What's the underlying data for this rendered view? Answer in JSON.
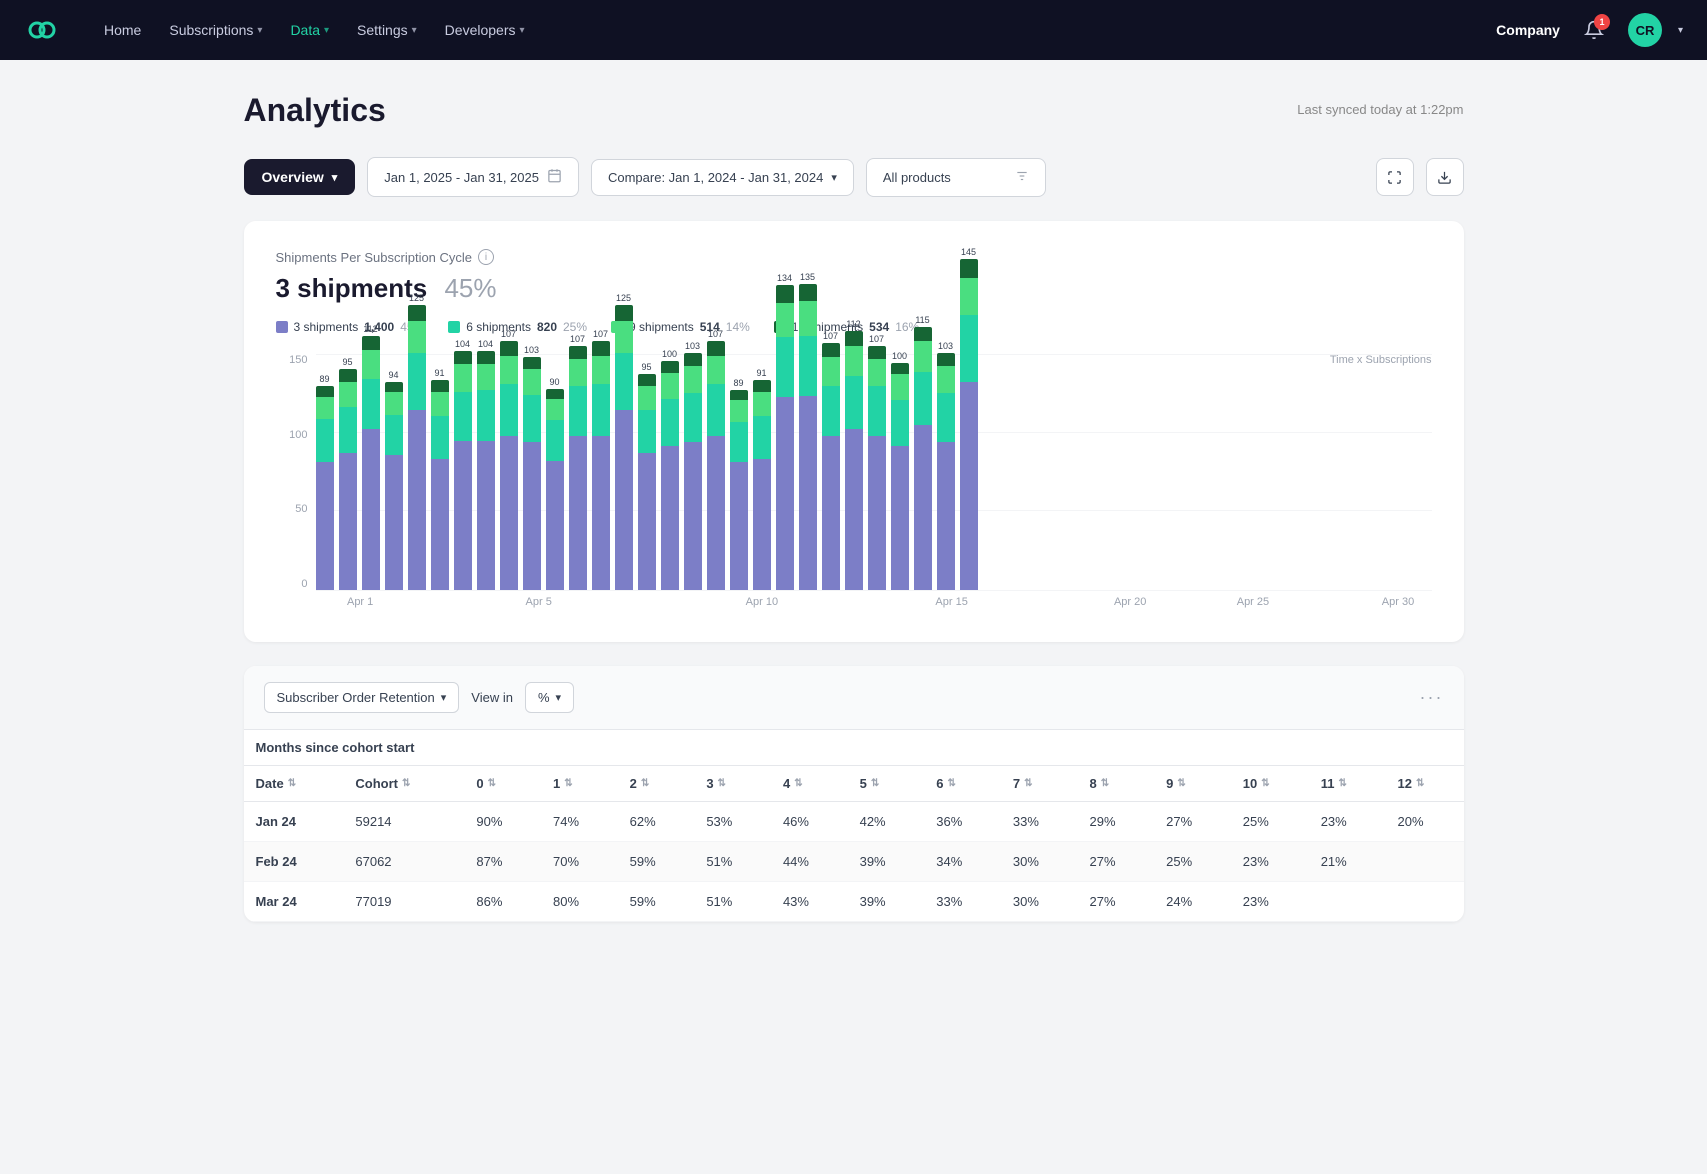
{
  "navbar": {
    "logo_alt": "Logo",
    "nav_items": [
      {
        "label": "Home",
        "active": false
      },
      {
        "label": "Subscriptions",
        "active": false,
        "has_chevron": true
      },
      {
        "label": "Data",
        "active": true,
        "has_chevron": true
      },
      {
        "label": "Settings",
        "active": false,
        "has_chevron": true
      },
      {
        "label": "Developers",
        "active": false,
        "has_chevron": true
      }
    ],
    "company": "Company",
    "notification_count": "1",
    "avatar_initials": "CR"
  },
  "page": {
    "title": "Analytics",
    "sync_text": "Last synced today at 1:22pm"
  },
  "toolbar": {
    "overview_label": "Overview",
    "date_range": "Jan 1, 2025 - Jan 31, 2025",
    "compare_label": "Compare: Jan 1, 2024 - Jan 31, 2024",
    "products_label": "All products"
  },
  "chart": {
    "title": "Shipments Per Subscription Cycle",
    "headline": "3 shipments",
    "headline_pct": "45%",
    "y_axis_label": "Time x Subscriptions",
    "legend": [
      {
        "label": "3 shipments",
        "color": "#7c7ec7",
        "count": "1,400",
        "pct": "45%"
      },
      {
        "label": "6 shipments",
        "color": "#22d3a5",
        "count": "820",
        "pct": "25%"
      },
      {
        "label": "9 shipments",
        "color": "#4ade80",
        "count": "514",
        "pct": "14%"
      },
      {
        "label": "12 shipments",
        "color": "#166534",
        "count": "534",
        "pct": "16%"
      }
    ],
    "y_ticks": [
      "150",
      "100",
      "50",
      "0"
    ],
    "x_labels": [
      {
        "label": "Apr 1",
        "pct": "4"
      },
      {
        "label": "Apr 5",
        "pct": "20"
      },
      {
        "label": "Apr 10",
        "pct": "40"
      },
      {
        "label": "Apr 15",
        "pct": "57"
      },
      {
        "label": "Apr 20",
        "pct": "73"
      },
      {
        "label": "Apr 25",
        "pct": "84"
      },
      {
        "label": "Apr 30",
        "pct": "97"
      }
    ],
    "bar_groups": [
      {
        "values": [
          89,
          30,
          15,
          8
        ],
        "labels": [
          "89",
          "",
          "",
          ""
        ]
      },
      {
        "values": [
          95,
          32,
          18,
          9
        ],
        "labels": [
          "95",
          "",
          "",
          ""
        ]
      },
      {
        "values": [
          112,
          35,
          20,
          10
        ],
        "labels": [
          "112",
          "",
          "",
          ""
        ]
      },
      {
        "values": [
          94,
          28,
          16,
          7
        ],
        "labels": [
          "94",
          "",
          "",
          ""
        ]
      },
      {
        "values": [
          125,
          40,
          22,
          11
        ],
        "labels": [
          "125",
          "",
          "",
          ""
        ]
      },
      {
        "values": [
          91,
          30,
          17,
          8
        ],
        "labels": [
          "91",
          "",
          "",
          ""
        ]
      },
      {
        "values": [
          104,
          34,
          19,
          9
        ],
        "labels": [
          "104",
          "",
          "",
          ""
        ]
      },
      {
        "values": [
          104,
          35,
          18,
          9
        ],
        "labels": [
          "104",
          "",
          "",
          ""
        ]
      },
      {
        "values": [
          107,
          36,
          20,
          10
        ],
        "labels": [
          "107",
          "",
          "",
          ""
        ]
      },
      {
        "values": [
          103,
          33,
          18,
          8
        ],
        "labels": [
          "103",
          "",
          "",
          ""
        ]
      },
      {
        "values": [
          90,
          28,
          15,
          7
        ],
        "labels": [
          "90",
          "",
          "",
          ""
        ]
      },
      {
        "values": [
          107,
          35,
          19,
          9
        ],
        "labels": [
          "107",
          "",
          "",
          ""
        ]
      },
      {
        "values": [
          107,
          36,
          20,
          10
        ],
        "labels": [
          "107",
          "",
          "",
          ""
        ]
      },
      {
        "values": [
          125,
          40,
          22,
          11
        ],
        "labels": [
          "125",
          "",
          "",
          ""
        ]
      },
      {
        "values": [
          95,
          30,
          17,
          8
        ],
        "labels": [
          "95",
          "",
          "",
          ""
        ]
      },
      {
        "values": [
          100,
          33,
          18,
          8
        ],
        "labels": [
          "100",
          "",
          "",
          ""
        ]
      },
      {
        "values": [
          103,
          34,
          19,
          9
        ],
        "labels": [
          "103",
          "",
          "",
          ""
        ]
      },
      {
        "values": [
          107,
          36,
          20,
          10
        ],
        "labels": [
          "107",
          "",
          "",
          ""
        ]
      },
      {
        "values": [
          89,
          28,
          15,
          7
        ],
        "labels": [
          "89",
          "",
          "",
          ""
        ]
      },
      {
        "values": [
          91,
          30,
          17,
          8
        ],
        "labels": [
          "91",
          "",
          "",
          ""
        ]
      },
      {
        "values": [
          134,
          42,
          24,
          12
        ],
        "labels": [
          "134",
          "",
          "",
          ""
        ]
      },
      {
        "values": [
          135,
          42,
          24,
          12
        ],
        "labels": [
          "135",
          "",
          "",
          ""
        ]
      },
      {
        "values": [
          107,
          35,
          20,
          10
        ],
        "labels": [
          "107",
          "",
          "",
          ""
        ]
      },
      {
        "values": [
          112,
          37,
          21,
          10
        ],
        "labels": [
          "112",
          "",
          "",
          ""
        ]
      },
      {
        "values": [
          107,
          35,
          19,
          9
        ],
        "labels": [
          "107",
          "",
          "",
          ""
        ]
      },
      {
        "values": [
          100,
          32,
          18,
          8
        ],
        "labels": [
          "100",
          "",
          "",
          ""
        ]
      },
      {
        "values": [
          115,
          37,
          21,
          10
        ],
        "labels": [
          "115",
          "",
          "",
          ""
        ]
      },
      {
        "values": [
          103,
          34,
          19,
          9
        ],
        "labels": [
          "103",
          "",
          "",
          ""
        ]
      },
      {
        "values": [
          145,
          46,
          26,
          13
        ],
        "labels": [
          "145",
          "",
          "",
          ""
        ]
      }
    ]
  },
  "retention": {
    "selector_label": "Subscriber Order Retention",
    "view_in_label": "View in",
    "view_in_value": "%",
    "three_dots": "···",
    "section_header": "Months since cohort start",
    "columns": [
      "Date",
      "Cohort",
      "0",
      "1",
      "2",
      "3",
      "4",
      "5",
      "6",
      "7",
      "8",
      "9",
      "10",
      "11",
      "12"
    ],
    "rows": [
      {
        "date": "Jan 24",
        "cohort": "59214",
        "0": "90%",
        "1": "74%",
        "2": "62%",
        "3": "53%",
        "4": "46%",
        "5": "42%",
        "6": "36%",
        "7": "33%",
        "8": "29%",
        "9": "27%",
        "10": "25%",
        "11": "23%",
        "12": "20%"
      },
      {
        "date": "Feb 24",
        "cohort": "67062",
        "0": "87%",
        "1": "70%",
        "2": "59%",
        "3": "51%",
        "4": "44%",
        "5": "39%",
        "6": "34%",
        "7": "30%",
        "8": "27%",
        "9": "25%",
        "10": "23%",
        "11": "21%",
        "12": ""
      },
      {
        "date": "Mar 24",
        "cohort": "77019",
        "0": "86%",
        "1": "80%",
        "2": "59%",
        "3": "51%",
        "4": "43%",
        "5": "39%",
        "6": "33%",
        "7": "30%",
        "8": "27%",
        "9": "24%",
        "10": "23%",
        "11": "",
        "12": ""
      }
    ]
  }
}
